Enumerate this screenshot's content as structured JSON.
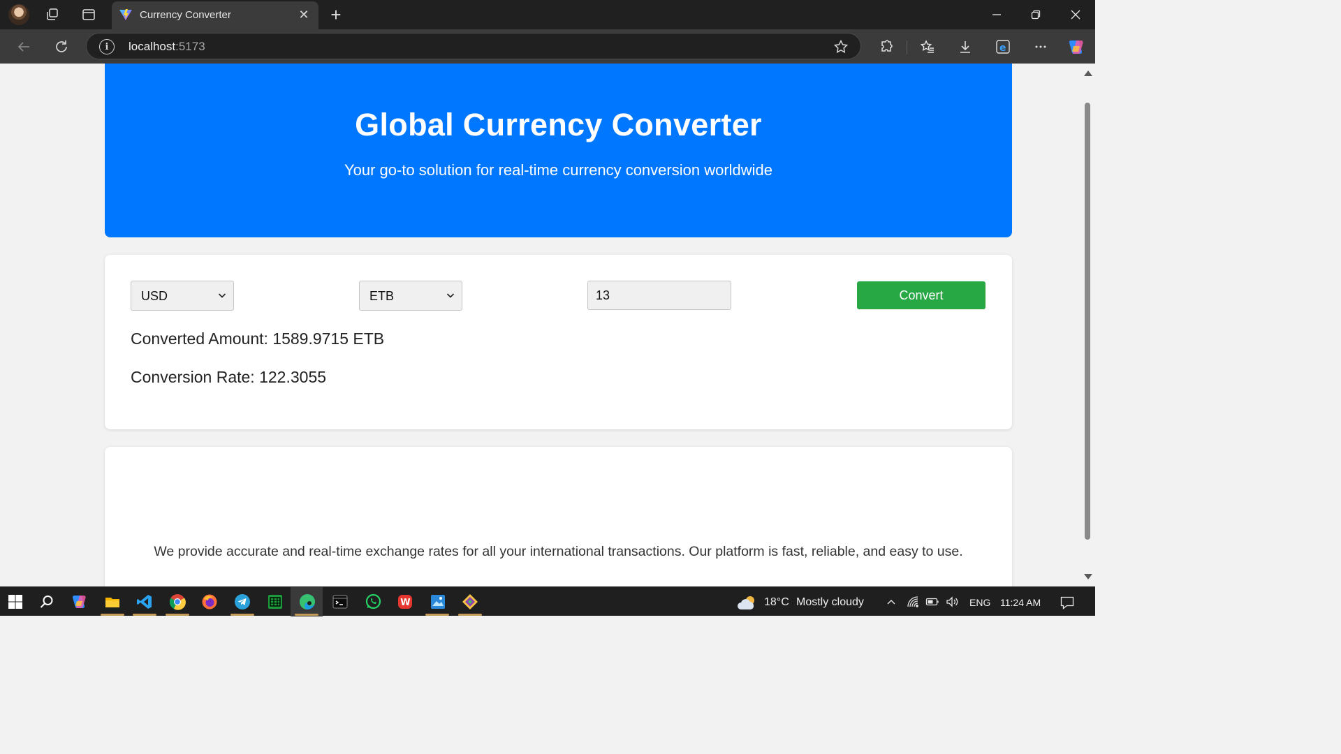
{
  "browser": {
    "tab_title": "Currency Converter",
    "url_host": "localhost",
    "url_port": ":5173"
  },
  "page": {
    "hero": {
      "title": "Global Currency Converter",
      "subtitle": "Your go-to solution for real-time currency conversion worldwide"
    },
    "converter": {
      "from_currency": "USD",
      "to_currency": "ETB",
      "amount": "13",
      "convert_label": "Convert",
      "converted_amount": "Converted Amount: 1589.9715 ETB",
      "conversion_rate": "Conversion Rate: 122.3055"
    },
    "about": {
      "text": "We provide accurate and real-time exchange rates for all your international transactions. Our platform is fast, reliable, and easy to use."
    }
  },
  "taskbar": {
    "weather_temp": "18°C",
    "weather_desc": "Mostly cloudy",
    "language": "ENG",
    "time": "11:24 AM"
  },
  "colors": {
    "hero_bg": "#0077ff",
    "convert_button": "#28a745",
    "page_bg": "#f2f2f2"
  }
}
